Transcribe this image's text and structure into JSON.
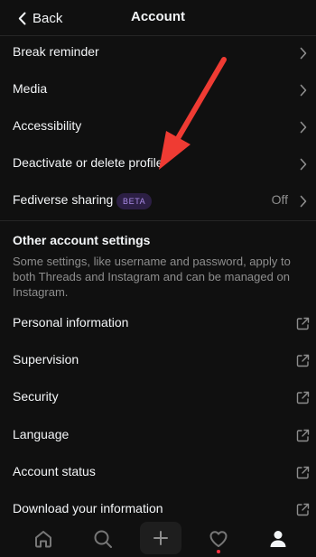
{
  "header": {
    "back_label": "Back",
    "title": "Account"
  },
  "settings": {
    "break_reminder": "Break reminder",
    "media": "Media",
    "accessibility": "Accessibility",
    "deactivate": "Deactivate or delete profile",
    "fediverse": {
      "label": "Fediverse sharing",
      "badge": "BETA",
      "status": "Off"
    }
  },
  "other": {
    "title": "Other account settings",
    "description": "Some settings, like username and password, apply to both Threads and Instagram and can be managed on Instagram.",
    "personal_information": "Personal information",
    "supervision": "Supervision",
    "security": "Security",
    "language": "Language",
    "account_status": "Account status",
    "download_information": "Download your information"
  },
  "tab_bar": {
    "icons": [
      "home-icon",
      "search-icon",
      "plus-icon",
      "heart-icon",
      "profile-icon"
    ],
    "active": "profile-icon",
    "notification_color": "#ff3040"
  },
  "annotation": {
    "arrow_color": "#ef3b33"
  },
  "colors": {
    "background": "#101010",
    "text": "#f3f5f7",
    "secondary_text": "#8e8e8e",
    "badge_background": "#2c1f44",
    "badge_text": "#a98be6"
  }
}
